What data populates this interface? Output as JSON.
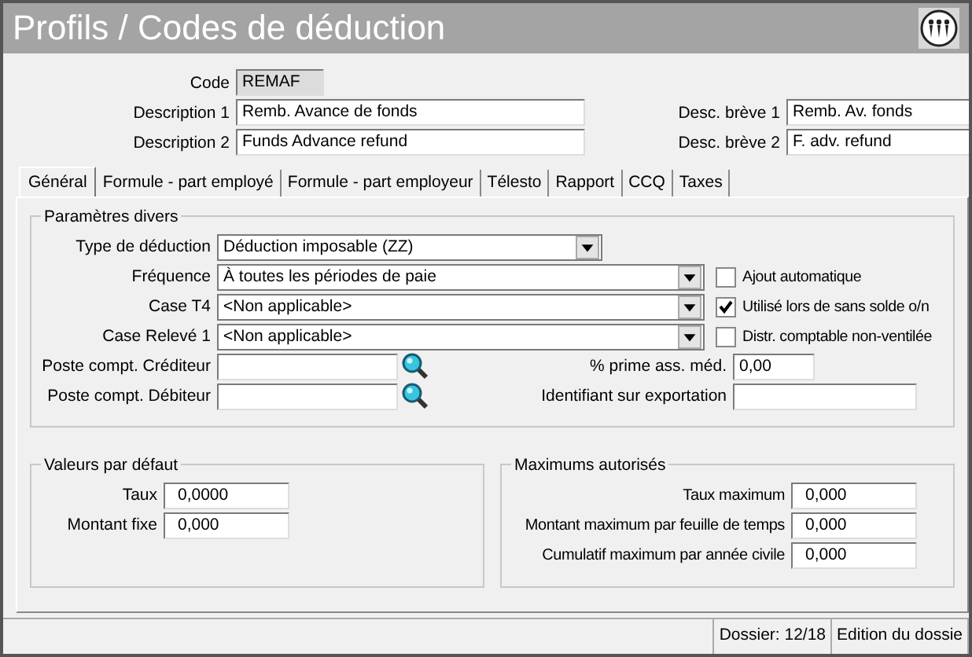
{
  "window": {
    "title": "Profils / Codes de déduction"
  },
  "header": {
    "code": {
      "label": "Code",
      "value": "REMAF",
      "disabled": true
    },
    "descriptions": [
      {
        "label": "Description 1",
        "value": "Remb. Avance de fonds"
      },
      {
        "label": "Description 2",
        "value": "Funds Advance refund"
      }
    ],
    "short_descriptions": [
      {
        "label": "Desc. brève 1",
        "value": "Remb. Av. fonds"
      },
      {
        "label": "Desc. brève 2",
        "value": "F. adv. refund"
      }
    ]
  },
  "tabs": [
    {
      "label": "Général",
      "selected": true
    },
    {
      "label": "Formule - part employé",
      "selected": false
    },
    {
      "label": "Formule - part employeur",
      "selected": false
    },
    {
      "label": "Télesto",
      "selected": false
    },
    {
      "label": "Rapport",
      "selected": false
    },
    {
      "label": "CCQ",
      "selected": false
    },
    {
      "label": "Taxes",
      "selected": false
    }
  ],
  "misc_parameters": {
    "title": "Paramètres divers",
    "dropdowns": [
      {
        "label": "Type de déduction",
        "value": "Déduction imposable (ZZ)"
      },
      {
        "label": "Fréquence",
        "value": "À toutes les périodes de paie"
      },
      {
        "label": "Case T4",
        "value": "<Non applicable>"
      },
      {
        "label": "Case Relevé 1",
        "value": "<Non applicable>"
      }
    ],
    "checkboxes": [
      {
        "label": "Ajout automatique",
        "checked": false
      },
      {
        "label": "Utilisé lors de sans solde o/n",
        "checked": true
      },
      {
        "label": "Distr. comptable non-ventilée",
        "checked": false
      }
    ],
    "lookups": [
      {
        "label": "Poste compt. Créditeur"
      },
      {
        "label": "Poste compt. Débiteur"
      }
    ],
    "fields": [
      {
        "label": "% prime ass. méd.",
        "value": "0,00"
      },
      {
        "label": "Identifiant sur exportation"
      }
    ]
  },
  "defaults": {
    "title": "Valeurs par défaut",
    "fields": [
      {
        "label": "Taux",
        "value": "0,0000"
      },
      {
        "label": "Montant fixe",
        "value": "0,000"
      }
    ]
  },
  "maximums": {
    "title": "Maximums autorisés",
    "fields": [
      {
        "label": "Taux maximum",
        "value": "0,000"
      },
      {
        "label": "Montant maximum par feuille de temps",
        "value": "0,000"
      },
      {
        "label": "Cumulatif maximum par année civile",
        "value": "0,000"
      }
    ]
  },
  "status_bar": [
    "Dossier: 12/18",
    "Edition du dossie"
  ]
}
